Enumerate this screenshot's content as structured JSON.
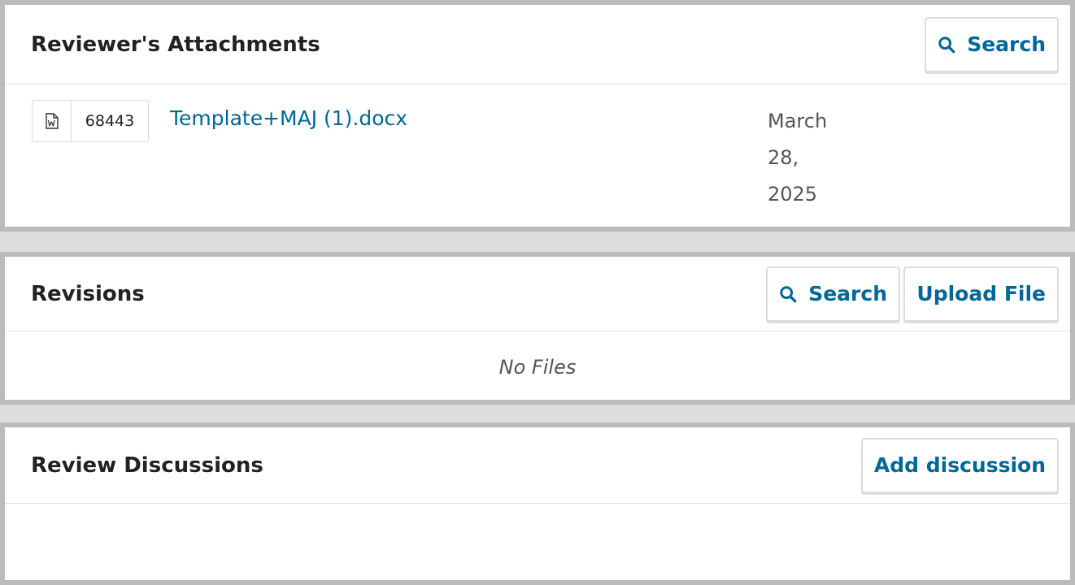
{
  "attachments": {
    "title": "Reviewer's Attachments",
    "search_label": "Search",
    "files": [
      {
        "type_icon": "word-document-icon",
        "id": "68443",
        "name": "Template+MAJ (1).docx",
        "date_line_1": "March",
        "date_line_2": "28,",
        "date_line_3": "2025"
      }
    ]
  },
  "revisions": {
    "title": "Revisions",
    "search_label": "Search",
    "upload_label": "Upload File",
    "empty_text": "No Files"
  },
  "discussions": {
    "title": "Review Discussions",
    "add_label": "Add discussion"
  },
  "colors": {
    "link": "#006798",
    "panel_border": "#bbbbbb",
    "button_border": "#dddddd"
  }
}
